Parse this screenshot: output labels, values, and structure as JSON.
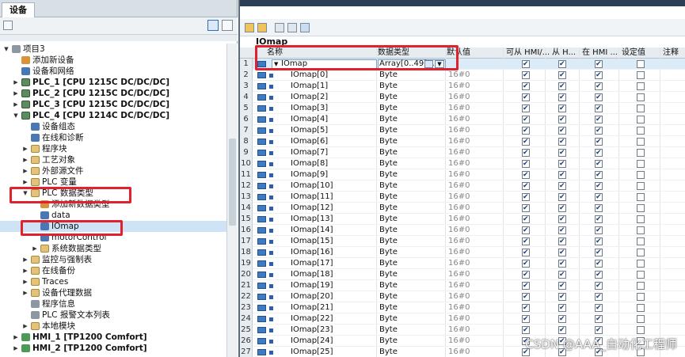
{
  "left_panel": {
    "tab_label": "设备"
  },
  "tree": [
    {
      "label": "项目3",
      "level": 0,
      "arrow": "▼",
      "icon": "project-icon",
      "bold": false
    },
    {
      "label": "添加新设备",
      "level": 1,
      "arrow": "",
      "icon": "add-device-icon",
      "bold": false
    },
    {
      "label": "设备和网络",
      "level": 1,
      "arrow": "",
      "icon": "network-icon",
      "bold": false
    },
    {
      "label": "PLC_1 [CPU 1215C DC/DC/DC]",
      "level": 1,
      "arrow": "▶",
      "icon": "plc-icon",
      "bold": true
    },
    {
      "label": "PLC_2 [CPU 1215C DC/DC/DC]",
      "level": 1,
      "arrow": "▶",
      "icon": "plc-icon",
      "bold": true
    },
    {
      "label": "PLC_3 [CPU 1215C DC/DC/DC]",
      "level": 1,
      "arrow": "▶",
      "icon": "plc-icon",
      "bold": true
    },
    {
      "label": "PLC_4 [CPU 1214C DC/DC/DC]",
      "level": 1,
      "arrow": "▼",
      "icon": "plc-icon",
      "bold": true
    },
    {
      "label": "设备组态",
      "level": 2,
      "arrow": "",
      "icon": "device-config-icon",
      "bold": false
    },
    {
      "label": "在线和诊断",
      "level": 2,
      "arrow": "",
      "icon": "diagnostics-icon",
      "bold": false
    },
    {
      "label": "程序块",
      "level": 2,
      "arrow": "▶",
      "icon": "folder-icon",
      "bold": false
    },
    {
      "label": "工艺对象",
      "level": 2,
      "arrow": "▶",
      "icon": "folder-icon",
      "bold": false
    },
    {
      "label": "外部源文件",
      "level": 2,
      "arrow": "▶",
      "icon": "folder-icon",
      "bold": false
    },
    {
      "label": "PLC 变量",
      "level": 2,
      "arrow": "▶",
      "icon": "folder-icon",
      "bold": false
    },
    {
      "label": "PLC 数据类型",
      "level": 2,
      "arrow": "▼",
      "icon": "folder-icon",
      "bold": false
    },
    {
      "label": "添加新数据类型",
      "level": 3,
      "arrow": "",
      "icon": "add-type-icon",
      "bold": false
    },
    {
      "label": "data",
      "level": 3,
      "arrow": "",
      "icon": "udt-icon",
      "bold": false
    },
    {
      "label": "IOmap",
      "level": 3,
      "arrow": "",
      "icon": "udt-icon",
      "bold": false,
      "selected": true
    },
    {
      "label": "motorControl",
      "level": 3,
      "arrow": "",
      "icon": "udt-icon",
      "bold": false
    },
    {
      "label": "系统数据类型",
      "level": 3,
      "arrow": "▶",
      "icon": "folder-icon",
      "bold": false
    },
    {
      "label": "监控与强制表",
      "level": 2,
      "arrow": "▶",
      "icon": "folder-icon",
      "bold": false
    },
    {
      "label": "在线备份",
      "level": 2,
      "arrow": "▶",
      "icon": "folder-icon",
      "bold": false
    },
    {
      "label": "Traces",
      "level": 2,
      "arrow": "▶",
      "icon": "folder-icon",
      "bold": false
    },
    {
      "label": "设备代理数据",
      "level": 2,
      "arrow": "▶",
      "icon": "folder-icon",
      "bold": false
    },
    {
      "label": "程序信息",
      "level": 2,
      "arrow": "",
      "icon": "program-info-icon",
      "bold": false
    },
    {
      "label": "PLC 报警文本列表",
      "level": 2,
      "arrow": "",
      "icon": "alarm-text-icon",
      "bold": false
    },
    {
      "label": "本地模块",
      "level": 2,
      "arrow": "▶",
      "icon": "folder-icon",
      "bold": false
    },
    {
      "label": "HMI_1 [TP1200 Comfort]",
      "level": 1,
      "arrow": "▶",
      "icon": "hmi-icon",
      "bold": true
    },
    {
      "label": "HMI_2 [TP1200 Comfort]",
      "level": 1,
      "arrow": "▶",
      "icon": "hmi-icon",
      "bold": true
    }
  ],
  "editor": {
    "title": "IOmap",
    "columns": {
      "name": "名称",
      "type": "数据类型",
      "default": "默认值",
      "hmi_access": "可从 HMI/...",
      "hmi_from": "从 H...",
      "hmi_in": "在 HMI ...",
      "setpoint": "设定值",
      "comment": "注释"
    },
    "first_row": {
      "num": "1",
      "name": "IOmap",
      "type": "Array[0..49]..."
    },
    "rows": [
      {
        "num": "2",
        "name": "IOmap[0]",
        "type": "Byte",
        "default": "16#0"
      },
      {
        "num": "3",
        "name": "IOmap[1]",
        "type": "Byte",
        "default": "16#0"
      },
      {
        "num": "4",
        "name": "IOmap[2]",
        "type": "Byte",
        "default": "16#0"
      },
      {
        "num": "5",
        "name": "IOmap[3]",
        "type": "Byte",
        "default": "16#0"
      },
      {
        "num": "6",
        "name": "IOmap[4]",
        "type": "Byte",
        "default": "16#0"
      },
      {
        "num": "7",
        "name": "IOmap[5]",
        "type": "Byte",
        "default": "16#0"
      },
      {
        "num": "8",
        "name": "IOmap[6]",
        "type": "Byte",
        "default": "16#0"
      },
      {
        "num": "9",
        "name": "IOmap[7]",
        "type": "Byte",
        "default": "16#0"
      },
      {
        "num": "10",
        "name": "IOmap[8]",
        "type": "Byte",
        "default": "16#0"
      },
      {
        "num": "11",
        "name": "IOmap[9]",
        "type": "Byte",
        "default": "16#0"
      },
      {
        "num": "12",
        "name": "IOmap[10]",
        "type": "Byte",
        "default": "16#0"
      },
      {
        "num": "13",
        "name": "IOmap[11]",
        "type": "Byte",
        "default": "16#0"
      },
      {
        "num": "14",
        "name": "IOmap[12]",
        "type": "Byte",
        "default": "16#0"
      },
      {
        "num": "15",
        "name": "IOmap[13]",
        "type": "Byte",
        "default": "16#0"
      },
      {
        "num": "16",
        "name": "IOmap[14]",
        "type": "Byte",
        "default": "16#0"
      },
      {
        "num": "17",
        "name": "IOmap[15]",
        "type": "Byte",
        "default": "16#0"
      },
      {
        "num": "18",
        "name": "IOmap[16]",
        "type": "Byte",
        "default": "16#0"
      },
      {
        "num": "19",
        "name": "IOmap[17]",
        "type": "Byte",
        "default": "16#0"
      },
      {
        "num": "20",
        "name": "IOmap[18]",
        "type": "Byte",
        "default": "16#0"
      },
      {
        "num": "21",
        "name": "IOmap[19]",
        "type": "Byte",
        "default": "16#0"
      },
      {
        "num": "22",
        "name": "IOmap[20]",
        "type": "Byte",
        "default": "16#0"
      },
      {
        "num": "23",
        "name": "IOmap[21]",
        "type": "Byte",
        "default": "16#0"
      },
      {
        "num": "24",
        "name": "IOmap[22]",
        "type": "Byte",
        "default": "16#0"
      },
      {
        "num": "25",
        "name": "IOmap[23]",
        "type": "Byte",
        "default": "16#0"
      },
      {
        "num": "26",
        "name": "IOmap[24]",
        "type": "Byte",
        "default": "16#0"
      },
      {
        "num": "27",
        "name": "IOmap[25]",
        "type": "Byte",
        "default": "16#0"
      }
    ]
  },
  "watermark": "CSDN @AAA_自动化工程师",
  "colors": {
    "highlight": "#e0212e",
    "selected_row": "#cfe3f7"
  }
}
